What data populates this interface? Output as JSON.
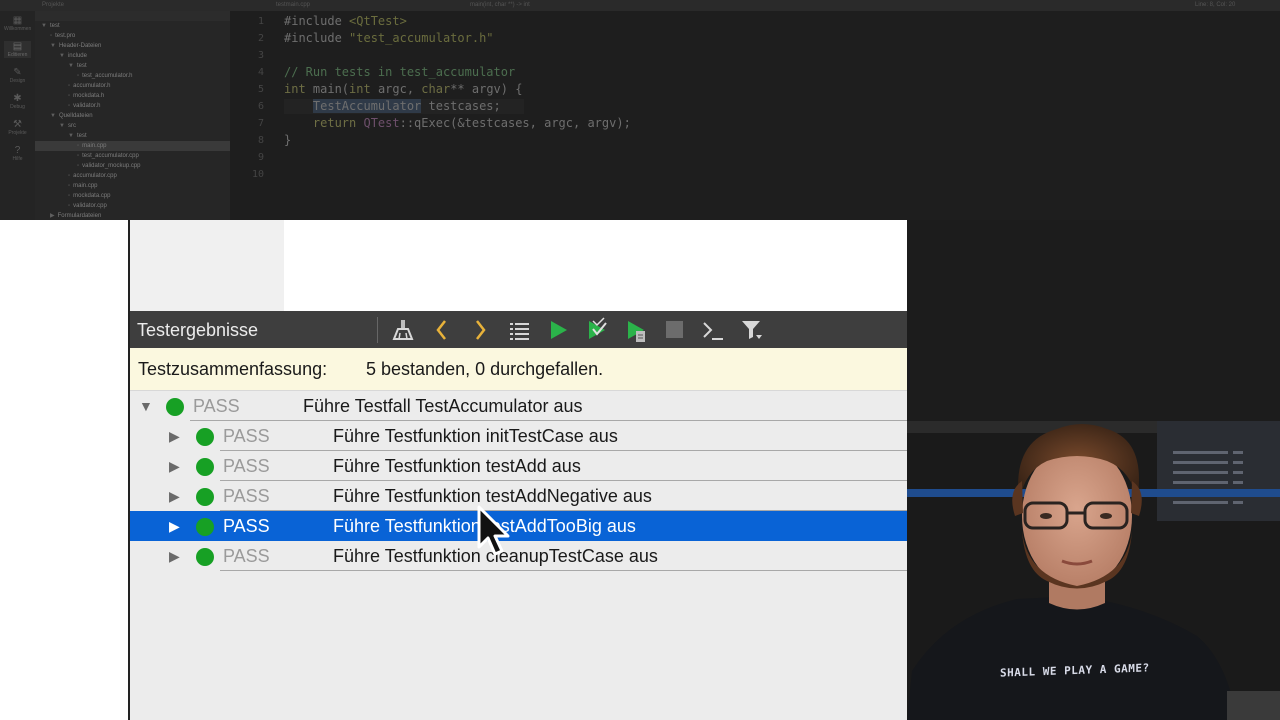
{
  "ide": {
    "topbar": [
      "Projekte",
      "testmain.cpp",
      "main(int, char **) -> int",
      "Line: 8, Col: 20"
    ],
    "modes": [
      "Willkommen",
      "Editieren",
      "Design",
      "Debug",
      "Projekte",
      "Hilfe"
    ],
    "tree": [
      {
        "label": "test",
        "indent": 0,
        "arrow": "▼"
      },
      {
        "label": "test.pro",
        "indent": 1,
        "arrow": ""
      },
      {
        "label": "Header-Dateien",
        "indent": 1,
        "arrow": "▼"
      },
      {
        "label": "include",
        "indent": 2,
        "arrow": "▼"
      },
      {
        "label": "test",
        "indent": 3,
        "arrow": "▼"
      },
      {
        "label": "test_accumulator.h",
        "indent": 4,
        "arrow": ""
      },
      {
        "label": "accumulator.h",
        "indent": 3,
        "arrow": ""
      },
      {
        "label": "mockdata.h",
        "indent": 3,
        "arrow": ""
      },
      {
        "label": "validator.h",
        "indent": 3,
        "arrow": ""
      },
      {
        "label": "Quelldateien",
        "indent": 1,
        "arrow": "▼"
      },
      {
        "label": "src",
        "indent": 2,
        "arrow": "▼"
      },
      {
        "label": "test",
        "indent": 3,
        "arrow": "▼"
      },
      {
        "label": "main.cpp",
        "indent": 4,
        "arrow": "",
        "selected": true
      },
      {
        "label": "test_accumulator.cpp",
        "indent": 4,
        "arrow": ""
      },
      {
        "label": "validator_mockup.cpp",
        "indent": 4,
        "arrow": ""
      },
      {
        "label": "accumulator.cpp",
        "indent": 3,
        "arrow": ""
      },
      {
        "label": "main.cpp",
        "indent": 3,
        "arrow": ""
      },
      {
        "label": "mockdata.cpp",
        "indent": 3,
        "arrow": ""
      },
      {
        "label": "validator.cpp",
        "indent": 3,
        "arrow": ""
      },
      {
        "label": "Formulardateien",
        "indent": 1,
        "arrow": "▶"
      }
    ],
    "code": {
      "line_numbers": [
        "1",
        "2",
        "3",
        "4",
        "5",
        "6",
        "7",
        "8",
        "9",
        "10"
      ],
      "l1a": "#include ",
      "l1b": "<QtTest>",
      "l2a": "#include ",
      "l2b": "\"test_accumulator.h\"",
      "l4": "// Run tests in test_accumulator",
      "l5a": "int ",
      "l5b": "main(",
      "l5c": "int ",
      "l5d": "argc, ",
      "l5e": "char",
      "l5f": "** argv) {",
      "l6a": "    ",
      "l6b": "TestAccumulator",
      "l6c": " testcases;",
      "l7a": "    ",
      "l7b": "return ",
      "l7c": "QTest",
      "l7d": "::qExec(&testcases, argc, argv);",
      "l8": "}"
    },
    "right_rows": [
      {
        "name": "test_accumulator.h",
        "num": "7"
      },
      {
        "name": "test_accumulator.h",
        "num": "27"
      },
      {
        "name": "test_accumulator.cpp",
        "num": "32"
      },
      {
        "name": "test_accumulator.cpp",
        "num": "33"
      },
      {
        "name": "test_accumulator.cpp",
        "num": "44",
        "selected": true
      },
      {
        "name": "test_accumulator.h",
        "num": "28"
      }
    ]
  },
  "panel": {
    "title": "Testergebnisse",
    "toolbar_icons": [
      "clean-icon",
      "previous-icon",
      "next-icon",
      "list-icon",
      "run-all-icon",
      "run-selected-icon",
      "run-file-icon",
      "stop-icon",
      "output-icon",
      "filter-icon"
    ],
    "summary_label": "Testzusammenfassung:",
    "summary_text": "5 bestanden, 0 durchgefallen.",
    "rows": [
      {
        "level": 0,
        "arrow": "▼",
        "status": "PASS",
        "text": "Führe Testfall TestAccumulator aus",
        "selected": false
      },
      {
        "level": 1,
        "arrow": "▶",
        "status": "PASS",
        "text": "Führe Testfunktion initTestCase aus",
        "selected": false
      },
      {
        "level": 1,
        "arrow": "▶",
        "status": "PASS",
        "text": "Führe Testfunktion testAdd aus",
        "selected": false
      },
      {
        "level": 1,
        "arrow": "▶",
        "status": "PASS",
        "text": "Führe Testfunktion testAddNegative aus",
        "selected": false
      },
      {
        "level": 1,
        "arrow": "▶",
        "status": "PASS",
        "text": "Führe Testfunktion testAddTooBig aus",
        "selected": true
      },
      {
        "level": 1,
        "arrow": "▶",
        "status": "PASS",
        "text": "Führe Testfunktion cleanupTestCase aus",
        "selected": false
      }
    ],
    "colors": {
      "pass_dot": "#17a024",
      "selection": "#0963d6",
      "summary_bg": "#fbf8df",
      "toolbar_bg": "#3e3e3e"
    }
  },
  "webcam": {
    "shirt_text": "SHALL WE PLAY A GAME?"
  }
}
